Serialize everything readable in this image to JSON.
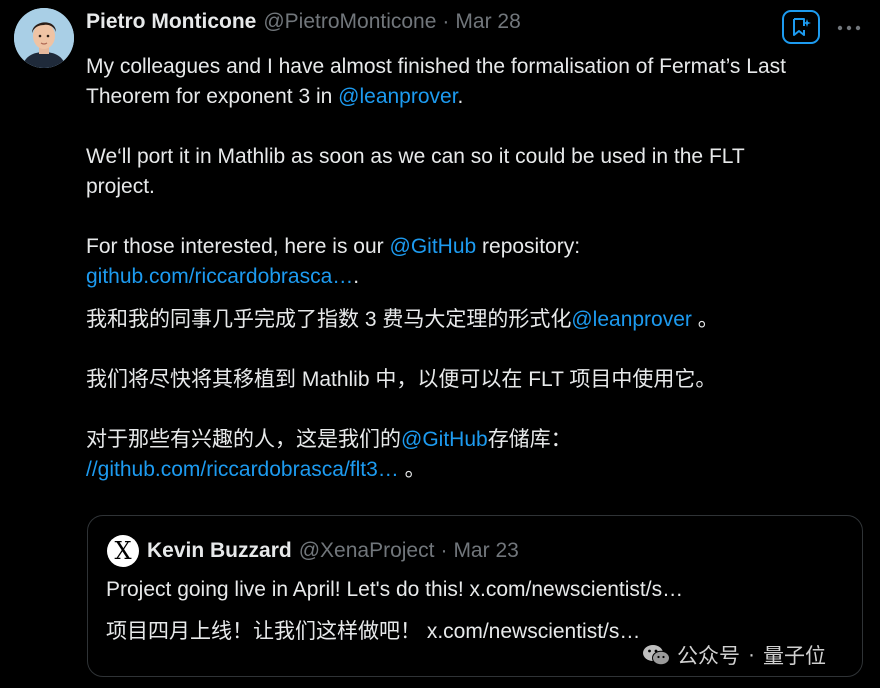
{
  "tweet": {
    "author_name": "Pietro Monticone",
    "author_handle": "@PietroMonticone",
    "dot": "·",
    "date": "Mar 28",
    "lines": {
      "l1": "My colleagues and I have almost finished the formalisation of Fermat’s Last",
      "l2_pre": "Theorem for exponent 3 in ",
      "l2_link": "@leanprover",
      "l2_post": ".",
      "l3": "We‘ll port it in Mathlib as soon as we can so it could be used in the FLT",
      "l4": "project.",
      "l5_pre": "For those interested, here is our ",
      "l5_link": "@GitHub",
      "l5_post": " repository:",
      "l6_link": "github.com/riccardobrasca…",
      "l6_post": ".",
      "zh1_pre": "我和我的同事几乎完成了指数 3 费马大定理的形式化",
      "zh1_link": "@leanprover",
      "zh1_post": " 。",
      "zh2": "我们将尽快将其移植到 Mathlib 中，以便可以在 FLT 项目中使用它。",
      "zh3_pre": "对于那些有兴趣的人，这是我们的",
      "zh3_link": "@GitHub",
      "zh3_post": "存储库：",
      "zh4_link": "//github.com/riccardobrasca/flt3…",
      "zh4_post": " 。"
    }
  },
  "quoted_tweet": {
    "author_name": "Kevin Buzzard",
    "author_handle": "@XenaProject",
    "dot": "·",
    "date": "Mar 23",
    "avatar_letter": "X",
    "line1": "Project going live in April! Let's do this! x.com/newscientist/s…",
    "line2": "项目四月上线！让我们这样做吧！ x.com/newscientist/s…"
  },
  "watermark": {
    "source": "公众号",
    "separator": "·",
    "name": "量子位"
  },
  "icons": {
    "grok": "grok-icon",
    "more": "more-icon",
    "wechat": "wechat-icon"
  },
  "colors": {
    "background": "#000000",
    "text": "#e7e9ea",
    "secondary": "#71767b",
    "link": "#1d9bf0",
    "border": "#2f3336"
  }
}
